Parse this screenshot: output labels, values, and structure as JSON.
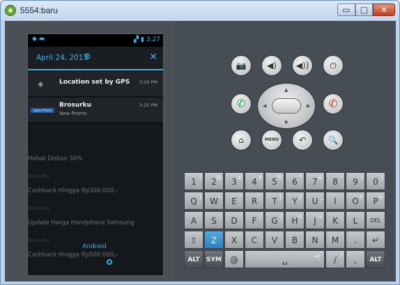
{
  "window": {
    "title": "5554:baru",
    "minimize": "▭",
    "maximize": "□",
    "close": "✕"
  },
  "status_bar": {
    "left": "◆ ▬",
    "time": "3:27",
    "icons": "▞ ▮"
  },
  "notification_header": {
    "date": "April 24, 2013",
    "settings_glyph": "⚙",
    "close_glyph": "✕"
  },
  "notifications": [
    {
      "title": "Location set by GPS",
      "subtitle": "",
      "time": "3:26 PM",
      "icon": "gps-icon"
    },
    {
      "title": "Brosurku",
      "subtitle": "New Promo",
      "time": "3:25 PM",
      "icon": "promo-icon",
      "badge": "Latest Promo"
    }
  ],
  "background_items": [
    "Hebat Diskon 50%",
    "Brosurku",
    "Cashback Hingga Rp300.000,-",
    "Brosurku",
    "Update Harga Handphone Samsung",
    "Brosurku",
    "Cashback Hingga Rp500.000,-"
  ],
  "background_android": "Android",
  "buttons": {
    "camera": "📷",
    "volume_down": "◀)",
    "volume_up": "◀))",
    "power": "⏻",
    "call": "✆",
    "end_call": "✆",
    "home": "⌂",
    "menu": "MENU",
    "back": "↶",
    "search": "🔍"
  },
  "keyboard": {
    "row1": [
      {
        "main": "1",
        "sup": "!"
      },
      {
        "main": "2",
        "sup": "@"
      },
      {
        "main": "3",
        "sup": "#"
      },
      {
        "main": "4",
        "sup": "$"
      },
      {
        "main": "5",
        "sup": "%"
      },
      {
        "main": "6",
        "sup": "^"
      },
      {
        "main": "7",
        "sup": "&"
      },
      {
        "main": "8",
        "sup": "*"
      },
      {
        "main": "9",
        "sup": "("
      },
      {
        "main": "0",
        "sup": ")"
      }
    ],
    "row2": [
      {
        "main": "Q",
        "sup": "|"
      },
      {
        "main": "W",
        "sup": "~"
      },
      {
        "main": "E",
        "sup": "\""
      },
      {
        "main": "R",
        "sup": "`"
      },
      {
        "main": "T",
        "sup": "{"
      },
      {
        "main": "Y",
        "sup": "}"
      },
      {
        "main": "U",
        "sup": "_"
      },
      {
        "main": "I",
        "sup": "-"
      },
      {
        "main": "O",
        "sup": "+"
      },
      {
        "main": "P",
        "sup": "="
      }
    ],
    "row3": [
      {
        "main": "A",
        "sup": ""
      },
      {
        "main": "S",
        "sup": "\\"
      },
      {
        "main": "D",
        "sup": "'"
      },
      {
        "main": "F",
        "sup": "["
      },
      {
        "main": "G",
        "sup": "]"
      },
      {
        "main": "H",
        "sup": "<"
      },
      {
        "main": "J",
        "sup": ">"
      },
      {
        "main": "K",
        "sup": ";"
      },
      {
        "main": "L",
        "sup": ":"
      },
      {
        "main": "DEL",
        "sup": ""
      }
    ],
    "row4": [
      {
        "main": "⇧",
        "sup": ""
      },
      {
        "main": "Z",
        "sup": ""
      },
      {
        "main": "X",
        "sup": ""
      },
      {
        "main": "C",
        "sup": ""
      },
      {
        "main": "V",
        "sup": ""
      },
      {
        "main": "B",
        "sup": ""
      },
      {
        "main": "N",
        "sup": ""
      },
      {
        "main": "M",
        "sup": ""
      },
      {
        "main": ".",
        "sup": ""
      },
      {
        "main": "↵",
        "sup": ""
      }
    ],
    "row5": {
      "alt_left": "ALT",
      "sym": "SYM",
      "at": "@",
      "space": "␣",
      "tab": "→|",
      "slash": "/",
      "slash_sup": "?",
      "comma": ",",
      "alt_right": "ALT"
    }
  }
}
